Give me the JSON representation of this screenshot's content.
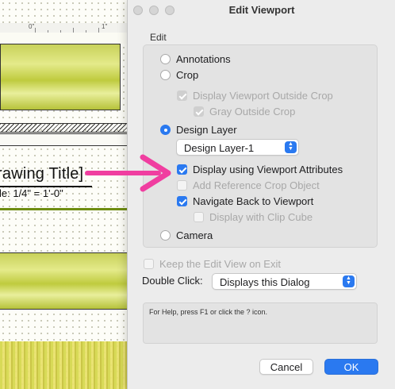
{
  "drawing": {
    "ruler_mark_0": "0\"",
    "ruler_mark_1": "1\"",
    "title": "rawing Title]",
    "scale": "le: 1/4\" = 1'-0\""
  },
  "dialog": {
    "title": "Edit Viewport",
    "group_label": "Edit",
    "options": {
      "annotations": "Annotations",
      "crop": "Crop",
      "display_outside_crop": "Display Viewport Outside Crop",
      "gray_outside_crop": "Gray Outside Crop",
      "design_layer": "Design Layer",
      "display_viewport_attributes": "Display using Viewport Attributes",
      "add_reference_crop": "Add Reference Crop Object",
      "navigate_back": "Navigate Back to Viewport",
      "display_clip_cube": "Display with Clip Cube",
      "camera": "Camera"
    },
    "design_layer_select": "Design Layer-1",
    "keep_edit_view": "Keep the Edit View on Exit",
    "double_click_label": "Double Click:",
    "double_click_select": "Displays this Dialog",
    "help_text": "For Help, press F1 or click the ? icon.",
    "cancel_label": "Cancel",
    "ok_label": "OK"
  },
  "colors": {
    "accent": "#2a79f0",
    "arrow": "#f03ea0",
    "panel_yellow": "#d8df6e"
  },
  "icons": [
    "close-dot-icon",
    "minimize-dot-icon",
    "zoom-dot-icon",
    "chevron-updown-icon",
    "pointer-arrow-icon"
  ]
}
